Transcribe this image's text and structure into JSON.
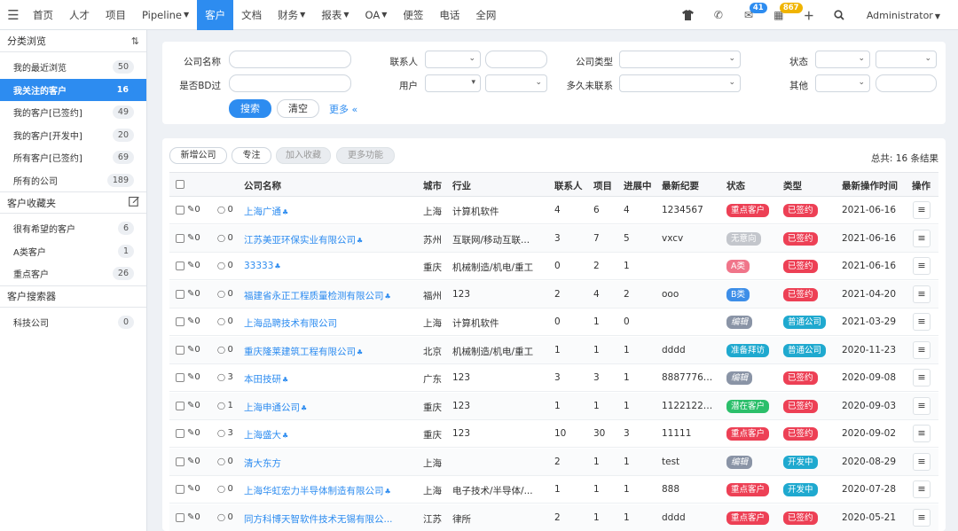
{
  "nav": {
    "items": [
      {
        "label": "首页",
        "dropdown": false,
        "active": false
      },
      {
        "label": "人才",
        "dropdown": false,
        "active": false
      },
      {
        "label": "项目",
        "dropdown": false,
        "active": false
      },
      {
        "label": "Pipeline",
        "dropdown": true,
        "active": false
      },
      {
        "label": "客户",
        "dropdown": false,
        "active": true
      },
      {
        "label": "文档",
        "dropdown": false,
        "active": false
      },
      {
        "label": "财务",
        "dropdown": true,
        "active": false
      },
      {
        "label": "报表",
        "dropdown": true,
        "active": false
      },
      {
        "label": "OA",
        "dropdown": true,
        "active": false
      },
      {
        "label": "便签",
        "dropdown": false,
        "active": false
      },
      {
        "label": "电话",
        "dropdown": false,
        "active": false
      },
      {
        "label": "全网",
        "dropdown": false,
        "active": false
      }
    ],
    "mail_count": "41",
    "calendar_count": "867",
    "user": "Administrator"
  },
  "sidebar": {
    "browse_title": "分类浏览",
    "browse_items": [
      {
        "label": "我的最近浏览",
        "count": "50",
        "active": false
      },
      {
        "label": "我关注的客户",
        "count": "16",
        "active": true
      },
      {
        "label": "我的客户[已签约]",
        "count": "49",
        "active": false
      },
      {
        "label": "我的客户[开发中]",
        "count": "20",
        "active": false
      },
      {
        "label": "所有客户[已签约]",
        "count": "69",
        "active": false
      },
      {
        "label": "所有的公司",
        "count": "189",
        "active": false
      }
    ],
    "fav_title": "客户收藏夹",
    "fav_items": [
      {
        "label": "很有希望的客户",
        "count": "6"
      },
      {
        "label": "A类客户",
        "count": "1"
      },
      {
        "label": "重点客户",
        "count": "26"
      }
    ],
    "search_title": "客户搜索器",
    "search_items": [
      {
        "label": "科技公司",
        "count": "0"
      }
    ]
  },
  "filter": {
    "company_name": "公司名称",
    "contact": "联系人",
    "company_type": "公司类型",
    "status": "状态",
    "is_bd": "是否BD过",
    "user": "用户",
    "last_contact": "多久未联系",
    "other": "其他",
    "search_btn": "搜索",
    "clear_btn": "清空",
    "more": "更多 «"
  },
  "toolbar": {
    "add": "新增公司",
    "focus": "专注",
    "add_fav": "加入收藏",
    "more": "更多功能",
    "total": "总共: 16 条结果"
  },
  "table": {
    "headers": {
      "name": "公司名称",
      "city": "城市",
      "industry": "行业",
      "contacts": "联系人",
      "projects": "项目",
      "progress": "进展中",
      "note": "最新纪要",
      "status": "状态",
      "type": "类型",
      "time": "最新操作时间",
      "op": "操作"
    },
    "rows": [
      {
        "attach": "0",
        "comments": "0",
        "name": "上海广通",
        "org": true,
        "city": "上海",
        "industry": "计算机软件",
        "contacts": "4",
        "projects": "6",
        "progress": "4",
        "note": "1234567",
        "status": "重点客户",
        "status_color": "#ed4055",
        "type": "已签约",
        "type_color": "#ed4055",
        "time": "2021-06-16"
      },
      {
        "attach": "0",
        "comments": "0",
        "name": "江苏美亚环保实业有限公司",
        "org": true,
        "city": "苏州",
        "industry": "互联网/移动互联...",
        "contacts": "3",
        "projects": "7",
        "progress": "5",
        "note": "vxcv",
        "status": "无意向",
        "status_color": "#c3c6cc",
        "type": "已签约",
        "type_color": "#ed4055",
        "time": "2021-06-16"
      },
      {
        "attach": "0",
        "comments": "0",
        "name": "33333",
        "org": true,
        "city": "重庆",
        "industry": "机械制造/机电/重工",
        "contacts": "0",
        "projects": "2",
        "progress": "1",
        "note": "",
        "status": "A类",
        "status_color": "#f0758a",
        "type": "已签约",
        "type_color": "#ed4055",
        "time": "2021-06-16"
      },
      {
        "attach": "0",
        "comments": "0",
        "name": "福建省永正工程质量检测有限公司",
        "org": true,
        "city": "福州",
        "industry": "123",
        "contacts": "2",
        "projects": "4",
        "progress": "2",
        "note": "ooo",
        "status": "B类",
        "status_color": "#3d8ee8",
        "type": "已签约",
        "type_color": "#ed4055",
        "time": "2021-04-20"
      },
      {
        "attach": "0",
        "comments": "0",
        "name": "上海品聘技术有限公司",
        "org": false,
        "city": "上海",
        "industry": "计算机软件",
        "contacts": "0",
        "projects": "1",
        "progress": "0",
        "note": "",
        "status": "编辑",
        "status_color": "#8a94a6",
        "type": "普通公司",
        "type_color": "#1fa9cf",
        "time": "2021-03-29"
      },
      {
        "attach": "0",
        "comments": "0",
        "name": "重庆隆莱建筑工程有限公司",
        "org": true,
        "city": "北京",
        "industry": "机械制造/机电/重工",
        "contacts": "1",
        "projects": "1",
        "progress": "1",
        "note": "dddd",
        "status": "准备拜访",
        "status_color": "#1fa9cf",
        "type": "普通公司",
        "type_color": "#1fa9cf",
        "time": "2020-11-23"
      },
      {
        "attach": "0",
        "comments": "3",
        "name": "本田技研",
        "org": true,
        "city": "广东",
        "industry": "123",
        "contacts": "3",
        "projects": "3",
        "progress": "1",
        "note": "88877766...",
        "status": "编辑",
        "status_color": "#8a94a6",
        "type": "已签约",
        "type_color": "#ed4055",
        "time": "2020-09-08"
      },
      {
        "attach": "0",
        "comments": "1",
        "name": "上海申通公司",
        "org": true,
        "city": "重庆",
        "industry": "123",
        "contacts": "1",
        "projects": "1",
        "progress": "1",
        "note": "11221221...",
        "status": "潜在客户",
        "status_color": "#2cbf6b",
        "type": "已签约",
        "type_color": "#ed4055",
        "time": "2020-09-03"
      },
      {
        "attach": "0",
        "comments": "3",
        "name": "上海盛大",
        "org": true,
        "city": "重庆",
        "industry": "123",
        "contacts": "10",
        "projects": "30",
        "progress": "3",
        "note": "11111",
        "status": "重点客户",
        "status_color": "#ed4055",
        "type": "已签约",
        "type_color": "#ed4055",
        "time": "2020-09-02"
      },
      {
        "attach": "0",
        "comments": "0",
        "name": "清大东方",
        "org": false,
        "city": "上海",
        "industry": "",
        "contacts": "2",
        "projects": "1",
        "progress": "1",
        "note": "test",
        "status": "编辑",
        "status_color": "#8a94a6",
        "type": "开发中",
        "type_color": "#1fa9cf",
        "time": "2020-08-29"
      },
      {
        "attach": "0",
        "comments": "0",
        "name": "上海华虹宏力半导体制造有限公司",
        "org": true,
        "city": "上海",
        "industry": "电子技术/半导体/...",
        "contacts": "1",
        "projects": "1",
        "progress": "1",
        "note": "888",
        "status": "重点客户",
        "status_color": "#ed4055",
        "type": "开发中",
        "type_color": "#1fa9cf",
        "time": "2020-07-28"
      },
      {
        "attach": "0",
        "comments": "0",
        "name": "同方科博天智软件技术无锡有限公...",
        "org": false,
        "city": "江苏",
        "industry": "律所",
        "contacts": "2",
        "projects": "1",
        "progress": "1",
        "note": "dddd",
        "status": "重点客户",
        "status_color": "#ed4055",
        "type": "已签约",
        "type_color": "#ed4055",
        "time": "2020-05-21"
      }
    ]
  },
  "icons": {
    "menu": "☰",
    "shirt": "👕",
    "phone": "✆",
    "mail": "✉",
    "calendar": "▦",
    "plus": "＋",
    "search": "⚲",
    "sort": "⇅",
    "edit": "✎",
    "attach": "✎",
    "comment": "◯",
    "org": "♣",
    "op": "≡"
  }
}
